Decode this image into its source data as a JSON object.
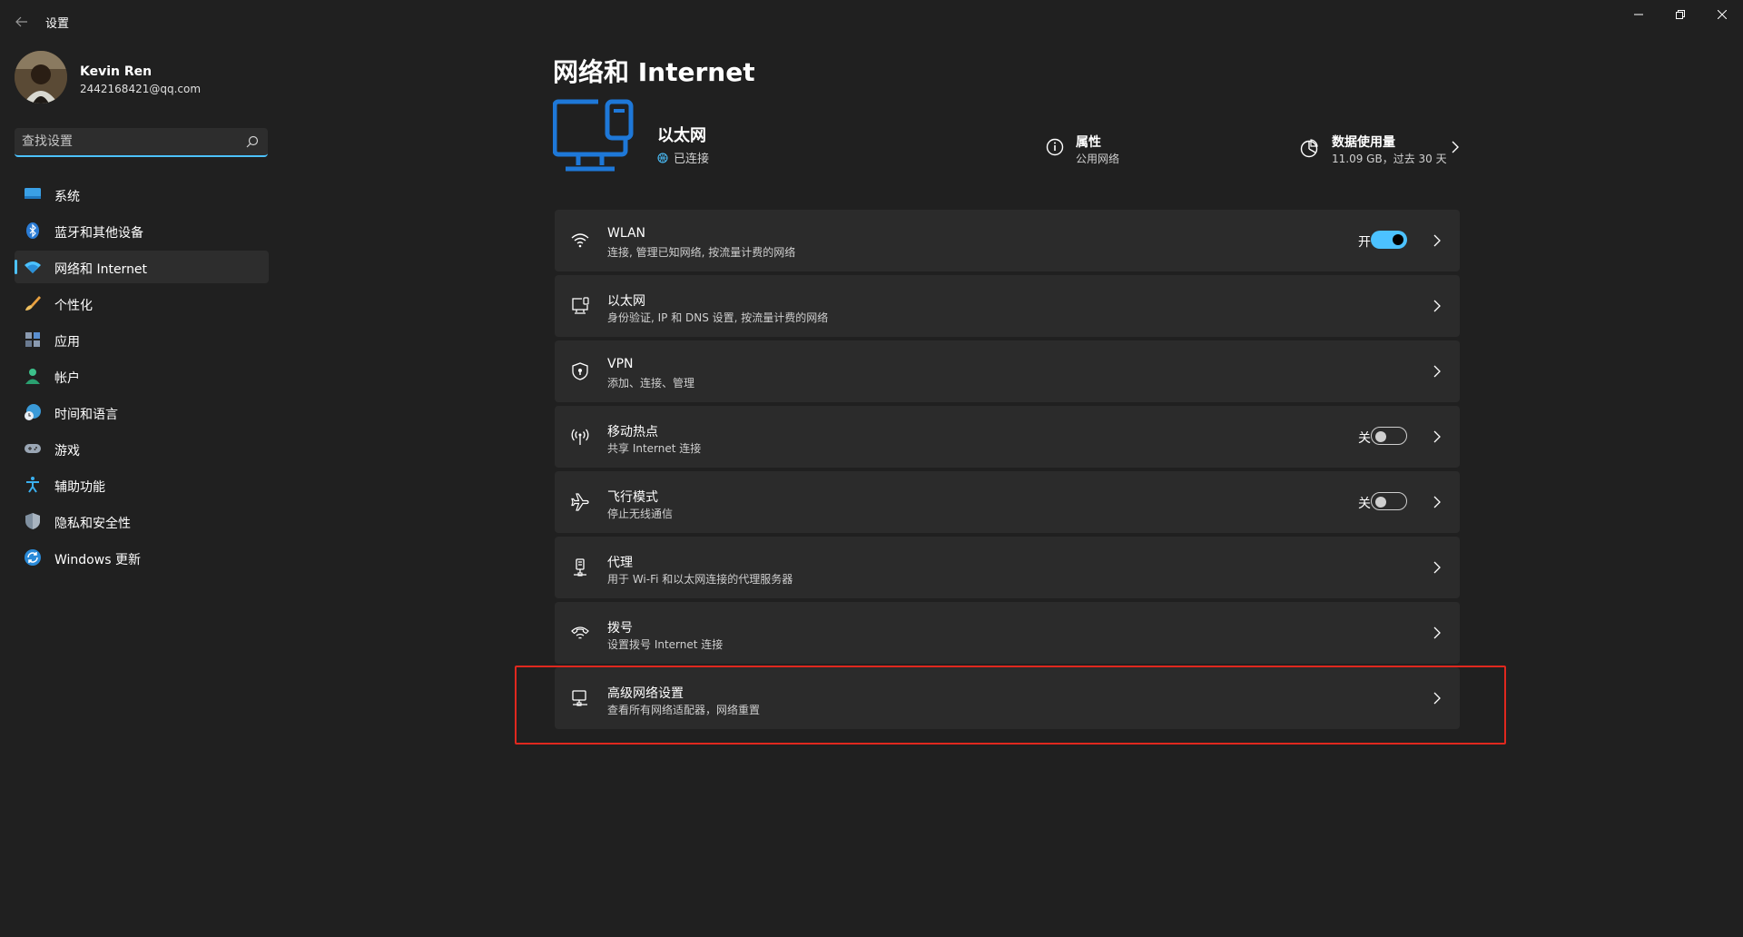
{
  "window": {
    "title": "设置"
  },
  "profile": {
    "name": "Kevin Ren",
    "email": "2442168421@qq.com"
  },
  "search": {
    "placeholder": "查找设置"
  },
  "sidebar": {
    "items": [
      {
        "label": "系统",
        "icon": "system-icon",
        "active": false
      },
      {
        "label": "蓝牙和其他设备",
        "icon": "bluetooth-icon",
        "active": false
      },
      {
        "label": "网络和 Internet",
        "icon": "network-icon",
        "active": true
      },
      {
        "label": "个性化",
        "icon": "brush-icon",
        "active": false
      },
      {
        "label": "应用",
        "icon": "apps-icon",
        "active": false
      },
      {
        "label": "帐户",
        "icon": "account-icon",
        "active": false
      },
      {
        "label": "时间和语言",
        "icon": "time-language-icon",
        "active": false
      },
      {
        "label": "游戏",
        "icon": "gamepad-icon",
        "active": false
      },
      {
        "label": "辅助功能",
        "icon": "accessibility-icon",
        "active": false
      },
      {
        "label": "隐私和安全性",
        "icon": "shield-icon",
        "active": false
      },
      {
        "label": "Windows 更新",
        "icon": "update-icon",
        "active": false
      }
    ]
  },
  "main": {
    "title": "网络和 Internet",
    "hero": {
      "name": "以太网",
      "status": "已连接",
      "properties_title": "属性",
      "properties_sub": "公用网络",
      "data_title": "数据使用量",
      "data_sub": "11.09 GB，过去 30 天"
    },
    "cards": [
      {
        "title": "WLAN",
        "desc": "连接, 管理已知网络, 按流量计费的网络",
        "icon": "wifi-icon",
        "toggle": "开",
        "toggle_on": true
      },
      {
        "title": "以太网",
        "desc": "身份验证, IP 和 DNS 设置, 按流量计费的网络",
        "icon": "ethernet-icon"
      },
      {
        "title": "VPN",
        "desc": "添加、连接、管理",
        "icon": "vpn-shield-icon"
      },
      {
        "title": "移动热点",
        "desc": "共享 Internet 连接",
        "icon": "hotspot-icon",
        "toggle": "关",
        "toggle_on": false
      },
      {
        "title": "飞行模式",
        "desc": "停止无线通信",
        "icon": "airplane-icon",
        "toggle": "关",
        "toggle_on": false
      },
      {
        "title": "代理",
        "desc": "用于 Wi-Fi 和以太网连接的代理服务器",
        "icon": "proxy-icon"
      },
      {
        "title": "拨号",
        "desc": "设置拨号 Internet 连接",
        "icon": "dialup-icon"
      },
      {
        "title": "高级网络设置",
        "desc": "查看所有网络适配器，网络重置",
        "icon": "advanced-network-icon"
      }
    ]
  },
  "colors": {
    "accent": "#4cc2ff",
    "background": "#202020",
    "card": "#2b2b2b",
    "highlight": "#e0281e"
  }
}
